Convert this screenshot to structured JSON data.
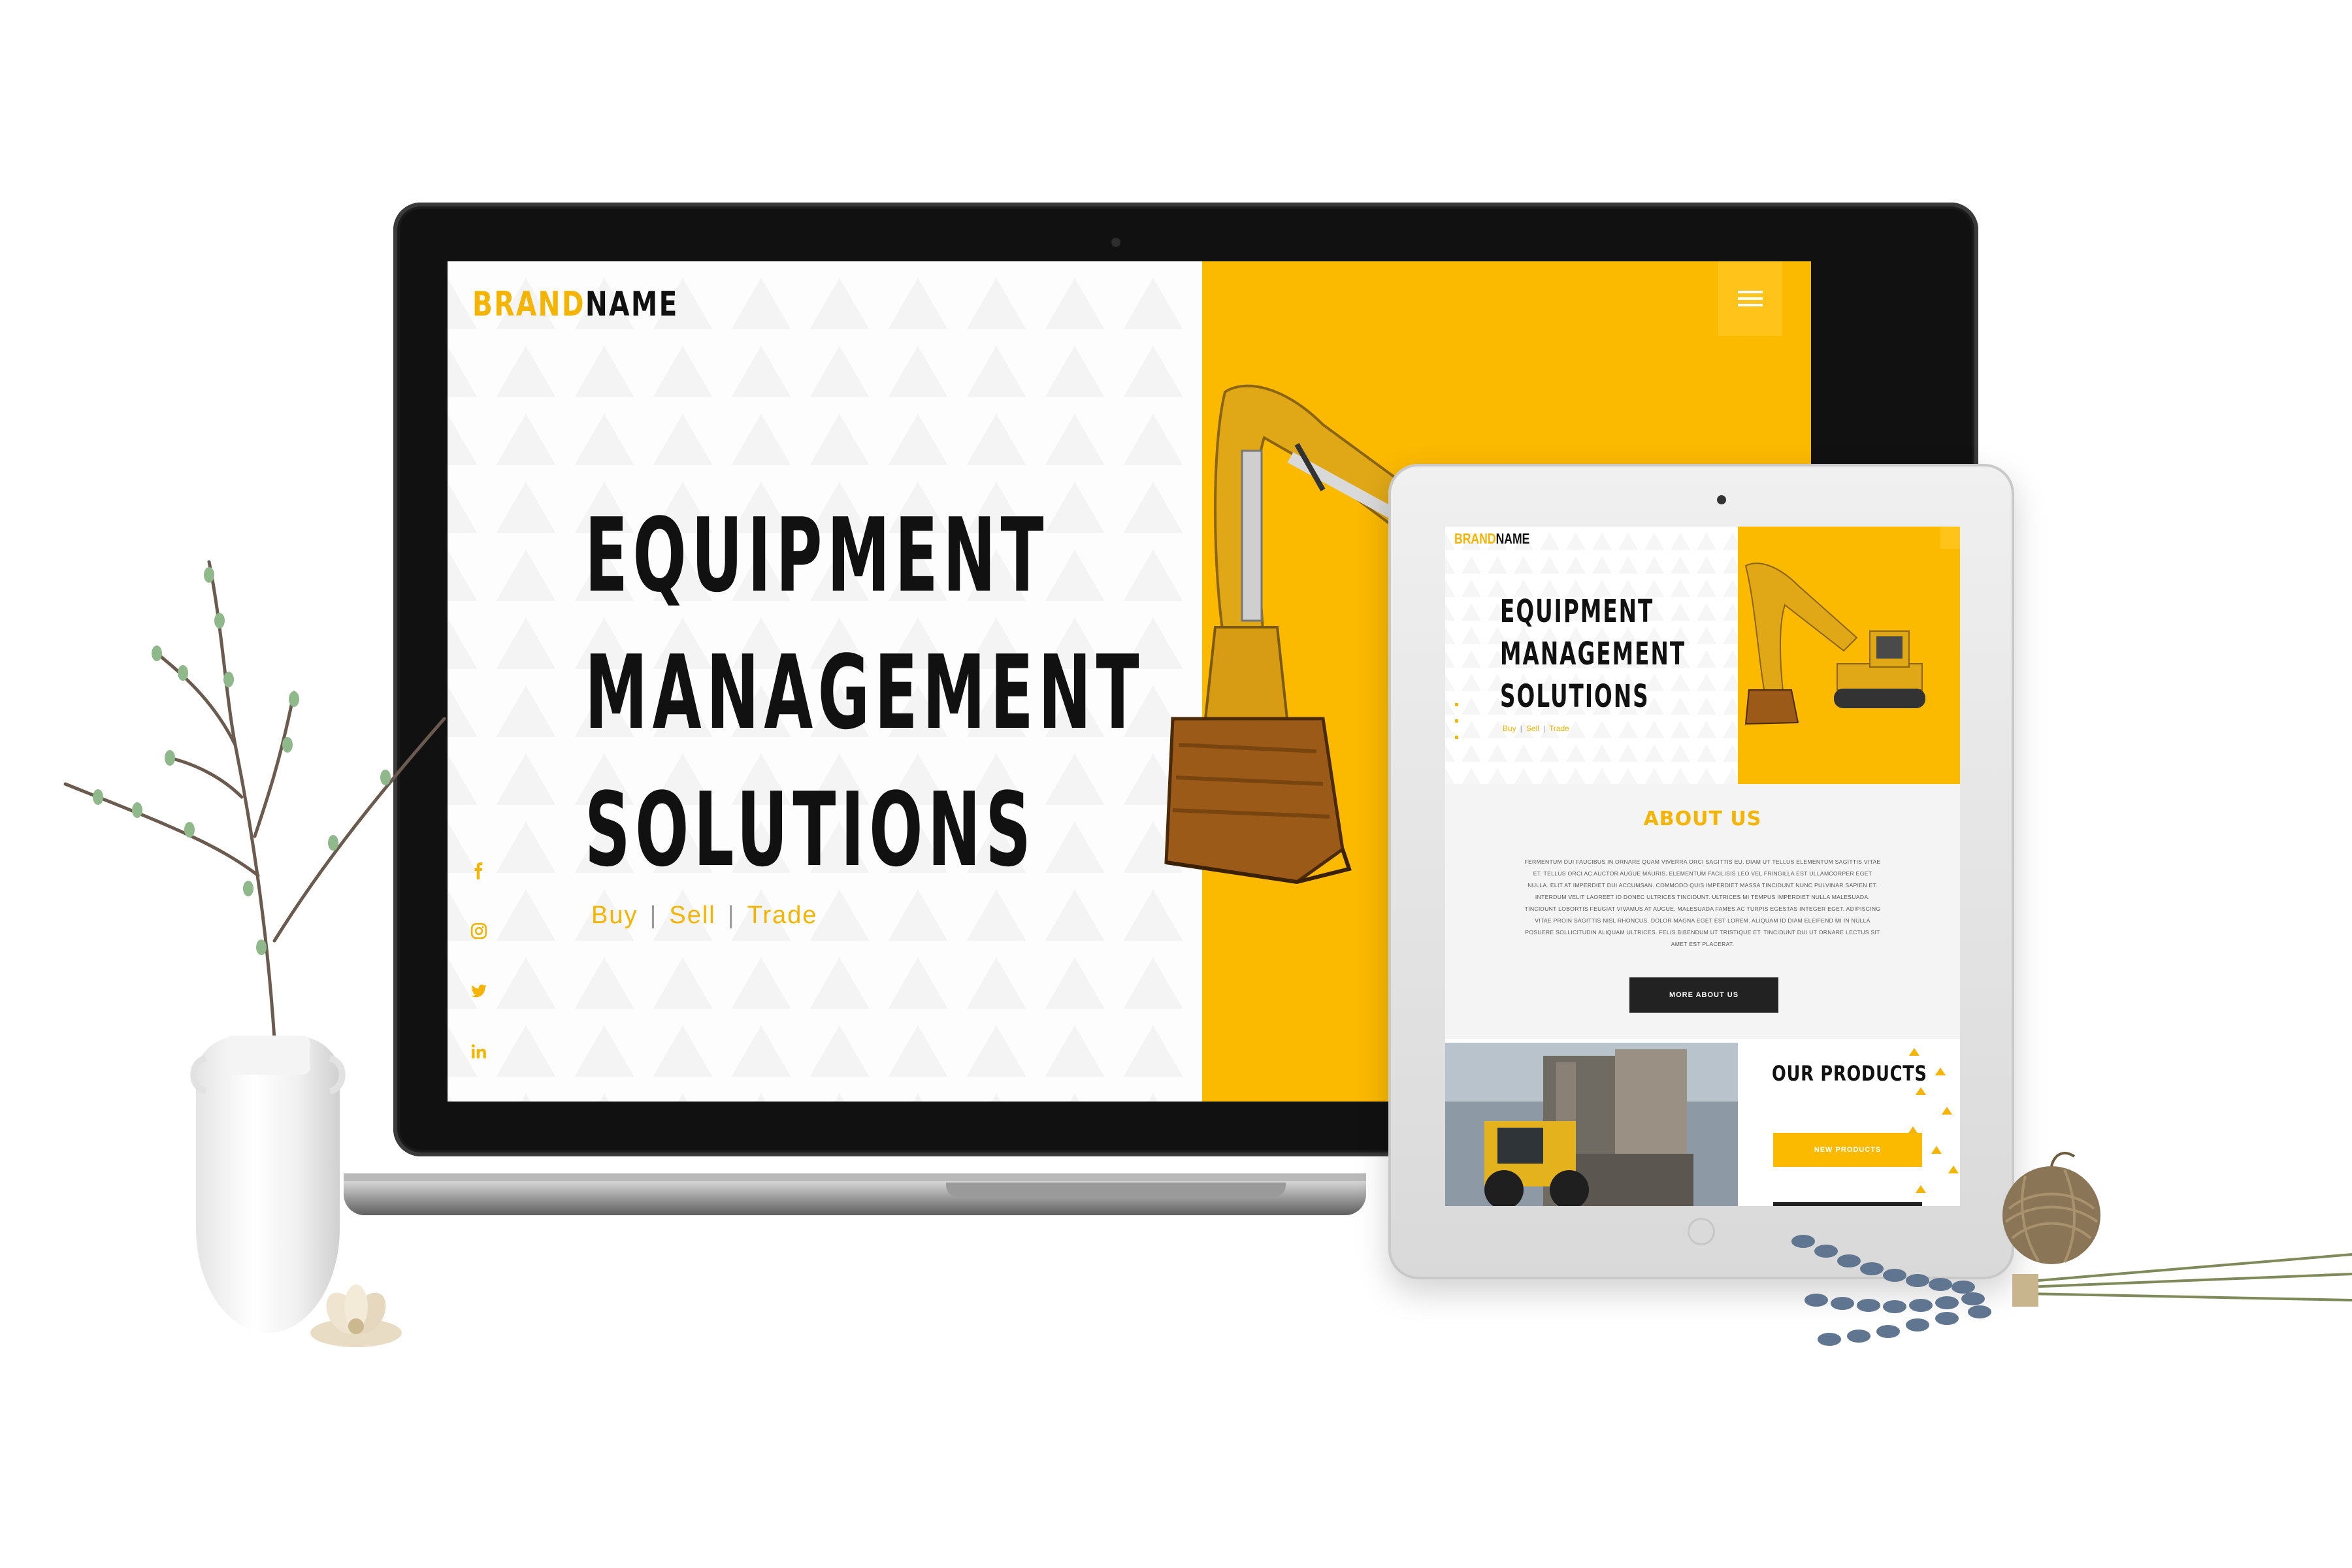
{
  "laptop": {
    "brand_part1": "BRAND",
    "brand_part2": "NAME",
    "hero_line1": "EQUIPMENT",
    "hero_line2": "MANAGEMENT",
    "hero_line3": "SOLUTIONS",
    "tagline": [
      "Buy",
      "|",
      "Sell",
      "|",
      "Trade"
    ],
    "social_icons": [
      "facebook-icon",
      "instagram-icon",
      "twitter-icon",
      "linkedin-icon"
    ],
    "menu_icon": "hamburger-menu-icon"
  },
  "tablet": {
    "brand_part1": "BRAND",
    "brand_part2": "NAME",
    "hero_line1": "EQUIPMENT",
    "hero_line2": "MANAGEMENT",
    "hero_line3": "SOLUTIONS",
    "tagline": [
      "Buy",
      "|",
      "Sell",
      "|",
      "Trade"
    ],
    "about_title": "ABOUT US",
    "about_text": "FERMENTUM DUI FAUCIBUS IN ORNARE QUAM VIVERRA ORCI SAGITTIS EU. DIAM UT TELLUS ELEMENTUM SAGITTIS VITAE ET. TELLUS ORCI AC AUCTOR AUGUE MAURIS. ELEMENTUM FACILISIS LEO VEL FRINGILLA EST ULLAMCORPER EGET NULLA. ELIT AT IMPERDIET DUI ACCUMSAN. COMMODO QUIS IMPERDIET MASSA TINCIDUNT NUNC PULVINAR SAPIEN ET. INTERDUM VELIT LAOREET ID DONEC ULTRICES TINCIDUNT. ULTRICES MI TEMPUS IMPERDIET NULLA MALESUADA. TINCIDUNT LOBORTIS FEUGIAT VIVAMUS AT AUGUE. MALESUADA FAMES AC TURPIS EGESTAS INTEGER EGET. ADIPISCING VITAE PROIN SAGITTIS NISL RHONCUS. DOLOR MAGNA EGET EST LOREM. ALIQUAM ID DIAM ELEIFEND MI IN NULLA POSUERE SOLLICITUDIN ALIQUAM ULTRICES. FELIS BIBENDUM UT TRISTIQUE ET. TINCIDUNT DUI UT ORNARE LECTUS SIT AMET EST PLACERAT.",
    "about_button": "MORE ABOUT US",
    "products_title": "OUR PRODUCTS",
    "products_button": "NEW PRODUCTS"
  },
  "colors": {
    "accent": "#fbb900",
    "dark": "#222222"
  }
}
